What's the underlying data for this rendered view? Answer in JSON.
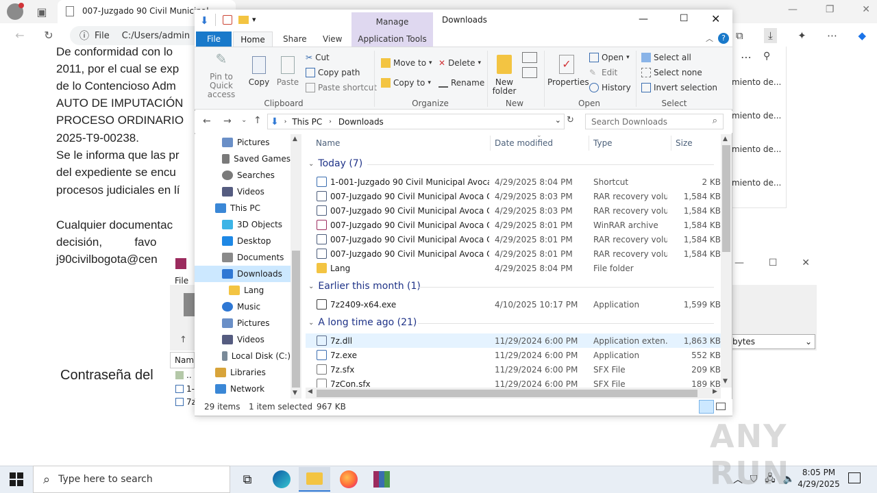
{
  "edge": {
    "tab_title": "007-Juzgado 90 Civil Municipal",
    "file_label": "File",
    "address": "C:/Users/admin",
    "doc_lines": [
      "De conformidad con lo",
      "2011, por el cual se exp",
      "de lo Contencioso Adm",
      "AUTO DE IMPUTACIÓN",
      "PROCESO ORDINARIO",
      "2025-T9-00238.",
      "Se le informa que las pr",
      "del expediente se encu",
      "procesos judiciales en lí",
      "Cualquier documentac",
      "decisión,          favo",
      "j90civilbogota@cen",
      "Contraseña del"
    ],
    "side_items": [
      "miento de...",
      "miento de...",
      "miento de...",
      "miento de..."
    ]
  },
  "winrar": {
    "file_menu": "File",
    "column_name": "Nam",
    "rows": [
      "..",
      "1-",
      "7z"
    ],
    "combo_value": "bytes"
  },
  "explorer": {
    "title": "Downloads",
    "manage_tab": "Manage",
    "tabs": {
      "file": "File",
      "home": "Home",
      "share": "Share",
      "view": "View",
      "app_tools": "Application Tools"
    },
    "ribbon": {
      "pin_label": "Pin to Quick access",
      "copy_label": "Copy",
      "paste_label": "Paste",
      "cut_label": "Cut",
      "copy_path_label": "Copy path",
      "paste_shortcut_label": "Paste shortcut",
      "clipboard_group": "Clipboard",
      "move_to_label": "Move to",
      "copy_to_label": "Copy to",
      "delete_label": "Delete",
      "rename_label": "Rename",
      "organize_group": "Organize",
      "new_folder_label": "New folder",
      "new_group": "New",
      "properties_label": "Properties",
      "open_label": "Open",
      "edit_label": "Edit",
      "history_label": "History",
      "open_group": "Open",
      "select_all_label": "Select all",
      "select_none_label": "Select none",
      "invert_selection_label": "Invert selection",
      "select_group": "Select"
    },
    "breadcrumb": {
      "this_pc": "This PC",
      "downloads": "Downloads"
    },
    "search_placeholder": "Search Downloads",
    "nav_items": [
      {
        "label": "Pictures",
        "color": "#6a8fc7"
      },
      {
        "label": "Saved Games",
        "color": "#7a7a7a"
      },
      {
        "label": "Searches",
        "color": "#7a7a7a"
      },
      {
        "label": "Videos",
        "color": "#555c80"
      },
      {
        "label": "This PC",
        "color": "#3a87d6"
      },
      {
        "label": "3D Objects",
        "color": "#3cb4e6"
      },
      {
        "label": "Desktop",
        "color": "#1e88e5"
      },
      {
        "label": "Documents",
        "color": "#8a8a8a"
      },
      {
        "label": "Downloads",
        "color": "#2f78d4"
      },
      {
        "label": "Lang",
        "color": "#f3c442"
      },
      {
        "label": "Music",
        "color": "#2f78d4"
      },
      {
        "label": "Pictures",
        "color": "#6a8fc7"
      },
      {
        "label": "Videos",
        "color": "#555c80"
      },
      {
        "label": "Local Disk (C:)",
        "color": "#7a8a99"
      },
      {
        "label": "Libraries",
        "color": "#d8a43a"
      },
      {
        "label": "Network",
        "color": "#3a87d6"
      }
    ],
    "columns": {
      "name": "Name",
      "date": "Date modified",
      "type": "Type",
      "size": "Size"
    },
    "groups": [
      {
        "title": "Today (7)"
      },
      {
        "title": "Earlier this month (1)"
      },
      {
        "title": "A long time ago (21)"
      }
    ],
    "files": [
      {
        "name": "1-001-Juzgado 90 Civil Municipal Avoca ...",
        "date": "4/29/2025 8:04 PM",
        "type": "Shortcut",
        "size": "2 KB"
      },
      {
        "name": "007-Juzgado 90 Civil Municipal Avoca Co...",
        "date": "4/29/2025 8:03 PM",
        "type": "RAR recovery volu...",
        "size": "1,584 KB"
      },
      {
        "name": "007-Juzgado 90 Civil Municipal Avoca Co...",
        "date": "4/29/2025 8:03 PM",
        "type": "RAR recovery volu...",
        "size": "1,584 KB"
      },
      {
        "name": "007-Juzgado 90 Civil Municipal Avoca Co...",
        "date": "4/29/2025 8:01 PM",
        "type": "WinRAR archive",
        "size": "1,584 KB"
      },
      {
        "name": "007-Juzgado 90 Civil Municipal Avoca Co...",
        "date": "4/29/2025 8:01 PM",
        "type": "RAR recovery volu...",
        "size": "1,584 KB"
      },
      {
        "name": "007-Juzgado 90 Civil Municipal Avoca Co...",
        "date": "4/29/2025 8:01 PM",
        "type": "RAR recovery volu...",
        "size": "1,584 KB"
      },
      {
        "name": "Lang",
        "date": "4/29/2025 8:04 PM",
        "type": "File folder",
        "size": ""
      },
      {
        "name": "7z2409-x64.exe",
        "date": "4/10/2025 10:17 PM",
        "type": "Application",
        "size": "1,599 KB"
      },
      {
        "name": "7z.dll",
        "date": "11/29/2024 6:00 PM",
        "type": "Application exten...",
        "size": "1,863 KB"
      },
      {
        "name": "7z.exe",
        "date": "11/29/2024 6:00 PM",
        "type": "Application",
        "size": "552 KB"
      },
      {
        "name": "7z.sfx",
        "date": "11/29/2024 6:00 PM",
        "type": "SFX File",
        "size": "209 KB"
      },
      {
        "name": "7zCon.sfx",
        "date": "11/29/2024 6:00 PM",
        "type": "SFX File",
        "size": "189 KB"
      }
    ],
    "status": {
      "items": "29 items",
      "selected": "1 item selected",
      "size": "967 KB"
    }
  },
  "taskbar": {
    "search_placeholder": "Type here to search",
    "time": "8:05 PM",
    "date": "4/29/2025"
  },
  "watermark": "ANY RUN"
}
